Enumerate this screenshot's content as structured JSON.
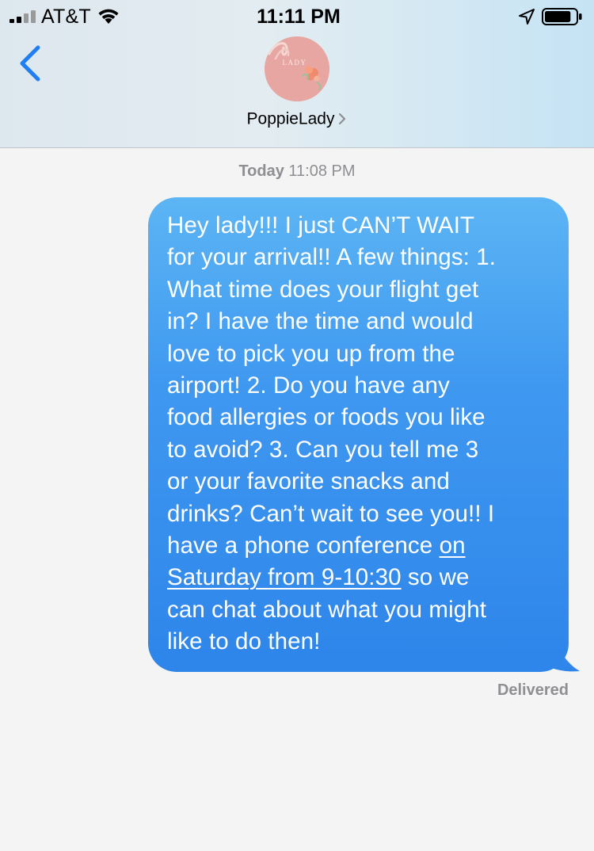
{
  "status_bar": {
    "carrier": "AT&T",
    "time": "11:11 PM",
    "signal_bars_active": 2,
    "signal_bars_total": 4,
    "battery_level": 0.85,
    "icons": [
      "signal-icon",
      "wifi-icon",
      "location-arrow-icon",
      "battery-icon"
    ]
  },
  "header": {
    "back_icon": "chevron-left-icon",
    "avatar_text": "LADY",
    "contact_name": "PoppieLady",
    "contact_chevron": "chevron-right-icon"
  },
  "conversation": {
    "timestamp_day": "Today",
    "timestamp_time": "11:08 PM",
    "message": {
      "lines_before_link": [
        "Hey lady!!! I just CAN’T WAIT",
        "for your arrival!! A few things: 1.",
        "What time does your flight get",
        "in? I have the time and would",
        "love to pick you up from the",
        "airport! 2. Do you have any",
        "food allergies or foods you like",
        "to avoid? 3. Can you tell me 3",
        "or your favorite snacks and",
        "drinks? Can’t wait to see you!! I"
      ],
      "link_line_prefix": "have a phone conference ",
      "link_part_1": "on",
      "link_part_2": "Saturday from 9-10:30",
      "link_line_suffix": " so we",
      "lines_after_link": [
        "can chat about what you might",
        "like to do then!"
      ]
    },
    "delivery_status": "Delivered"
  },
  "colors": {
    "bubble_top": "#5cb5f4",
    "bubble_bottom": "#2e85ea",
    "ios_blue": "#1f7ef2",
    "meta_gray": "#8e8e93"
  }
}
